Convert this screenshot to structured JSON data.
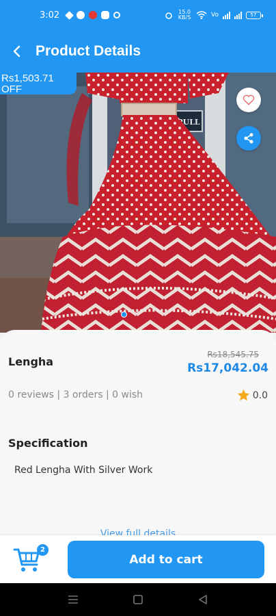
{
  "status_bar": {
    "time": "3:02",
    "network_speed": "15.0 KB/S",
    "battery_level": "57"
  },
  "app_bar": {
    "title": "Product Details",
    "back_icon": "back-arrow-icon"
  },
  "hero": {
    "discount_badge": "Rs1,503.71 OFF",
    "shop_sign": "PULL",
    "favorite_icon": "heart-outline-icon",
    "share_icon": "share-icon",
    "carousel_pages": 1,
    "active_page": 1
  },
  "product": {
    "name": "Lengha",
    "old_price": "Rs18,545.75",
    "price": "Rs17,042.04",
    "stats": "0 reviews | 3 orders | 0 wish",
    "rating": "0.0"
  },
  "specification": {
    "heading": "Specification",
    "text": "Red Lengha With Silver Work",
    "view_more": "View full details"
  },
  "bottom_bar": {
    "cart_count": "2",
    "add_to_cart_label": "Add to cart"
  },
  "colors": {
    "primary": "#2196f3",
    "price": "#1e88e5",
    "star": "#f4a81d",
    "dress": "#c8202c"
  }
}
